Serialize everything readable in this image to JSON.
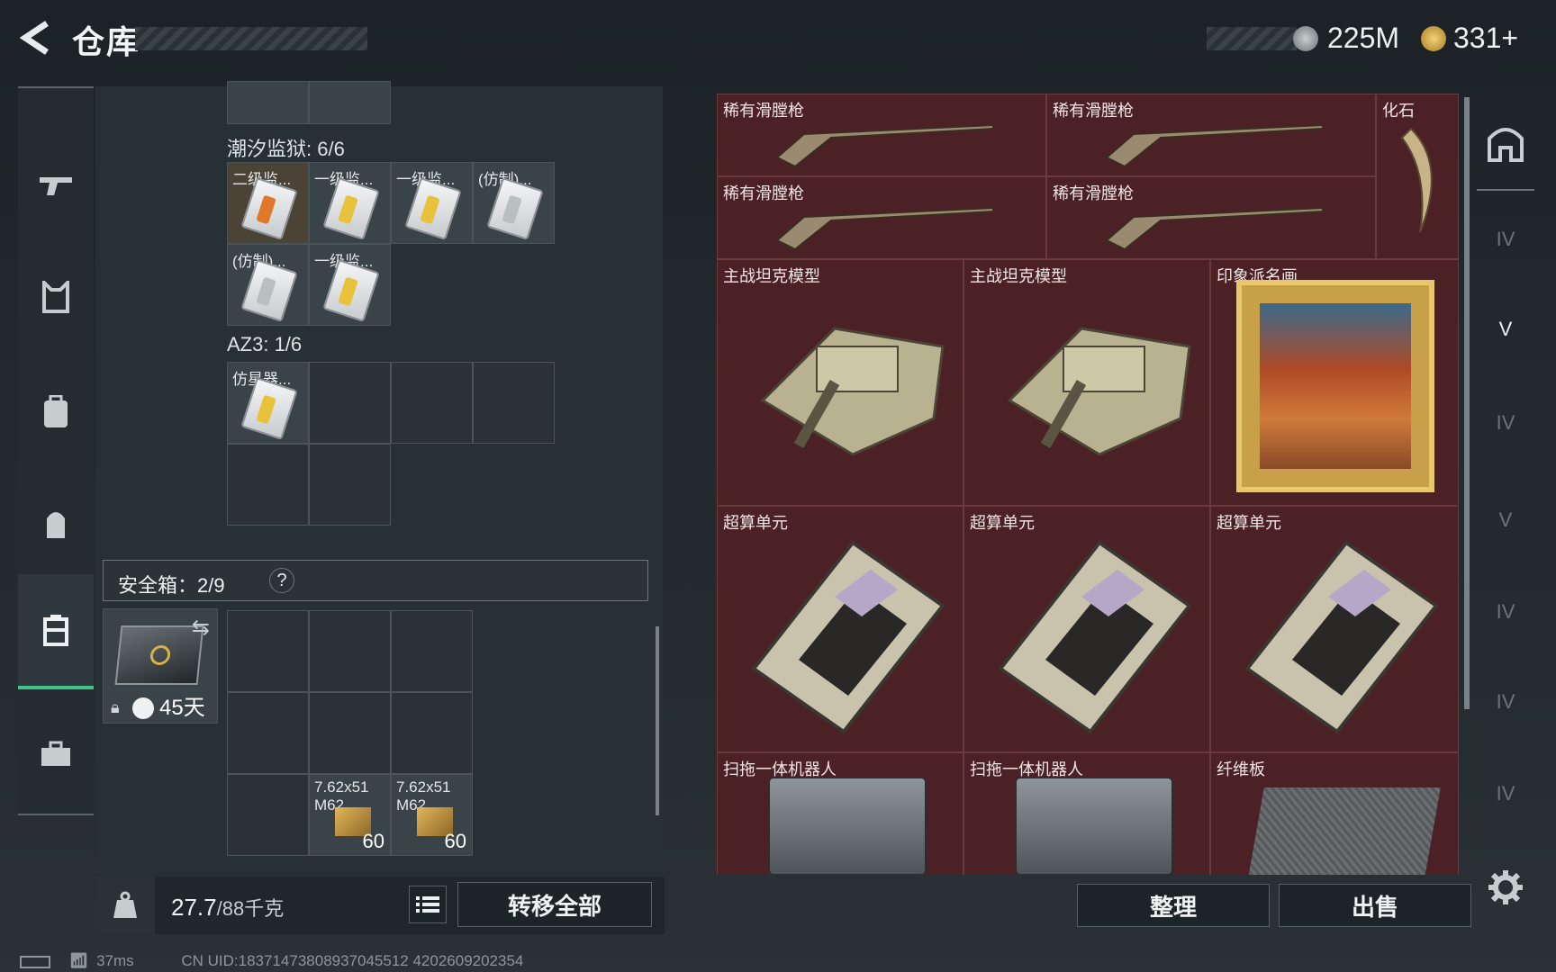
{
  "header": {
    "title": "仓库",
    "currency1": "225M",
    "currency2": "331+"
  },
  "left_nav": {
    "items": [
      "weapon-icon",
      "armor-icon",
      "backpack-icon",
      "bag-icon",
      "container-icon",
      "briefcase-icon"
    ],
    "active_index": 4
  },
  "tidal_prison": {
    "label": "潮汐监狱: 6/6",
    "items": [
      "二级监...",
      "一级监...",
      "一级监...",
      "(仿制)...",
      "(仿制)...",
      "一级监..."
    ]
  },
  "az3": {
    "label": "AZ3: 1/6",
    "items": [
      "仿星器..."
    ]
  },
  "safe_box": {
    "label": "安全箱：2/9",
    "help": "?",
    "duration": "45天"
  },
  "ammo": [
    {
      "name": "7.62x51 M62",
      "count": "60"
    },
    {
      "name": "7.62x51 M62",
      "count": "60"
    }
  ],
  "weight": {
    "current": "27.7",
    "total": "/88千克"
  },
  "transfer_all": "转移全部",
  "stash": {
    "row1": [
      "稀有滑膛枪",
      "稀有滑膛枪",
      "化石"
    ],
    "row2": [
      "稀有滑膛枪",
      "稀有滑膛枪"
    ],
    "row3": [
      "主战坦克模型",
      "主战坦克模型",
      "印象派名画"
    ],
    "row4": [
      "超算单元",
      "超算单元",
      "超算单元"
    ],
    "row5": [
      "扫拖一体机器人",
      "扫拖一体机器人",
      "纤维板"
    ]
  },
  "buttons": {
    "organize": "整理",
    "sell": "出售"
  },
  "right_nav": {
    "items": [
      "home-icon",
      "IV",
      "V",
      "IV",
      "V",
      "IV",
      "IV",
      "IV"
    ]
  },
  "status": {
    "ping": "37ms",
    "uid": "CN UID:18371473808937045512 4202609202354"
  }
}
